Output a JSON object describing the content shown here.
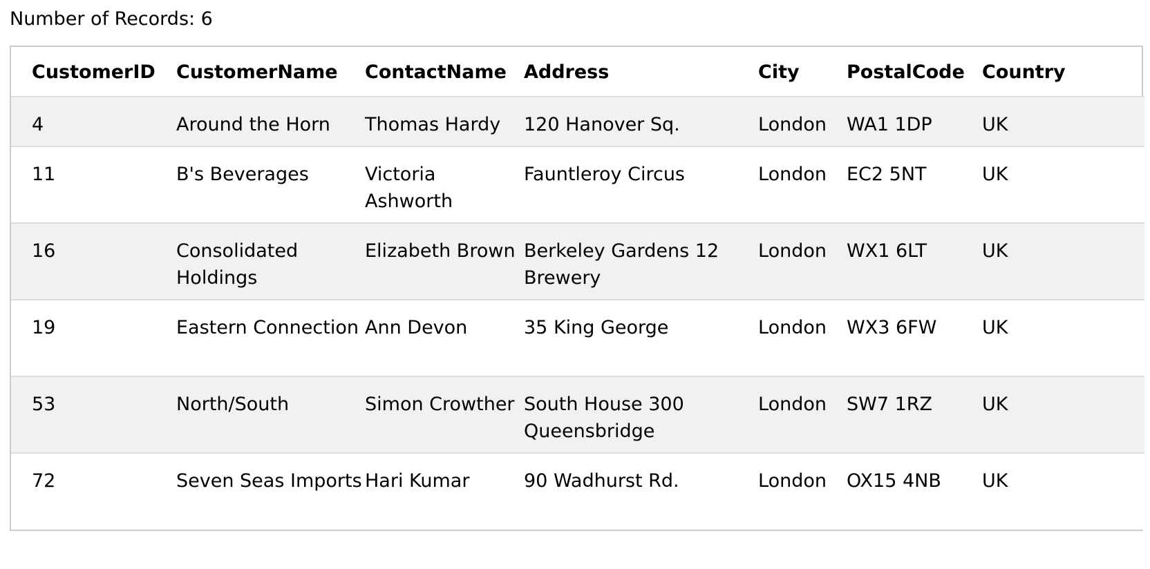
{
  "summary": {
    "records_label": "Number of Records: 6"
  },
  "table": {
    "headers": [
      "CustomerID",
      "CustomerName",
      "ContactName",
      "Address",
      "City",
      "PostalCode",
      "Country"
    ],
    "rows": [
      [
        "4",
        "Around the Horn",
        "Thomas Hardy",
        "120 Hanover Sq.",
        "London",
        "WA1 1DP",
        "UK"
      ],
      [
        "11",
        "B's Beverages",
        "Victoria Ashworth",
        "Fauntleroy Circus",
        "London",
        "EC2 5NT",
        "UK"
      ],
      [
        "16",
        "Consolidated Holdings",
        "Elizabeth Brown",
        "Berkeley Gardens 12 Brewery",
        "London",
        "WX1 6LT",
        "UK"
      ],
      [
        "19",
        "Eastern Connection",
        "Ann Devon",
        "35 King George",
        "London",
        "WX3 6FW",
        "UK"
      ],
      [
        "53",
        "North/South",
        "Simon Crowther",
        "South House 300 Queensbridge",
        "London",
        "SW7 1RZ",
        "UK"
      ],
      [
        "72",
        "Seven Seas Imports",
        "Hari Kumar",
        "90 Wadhurst Rd.",
        "London",
        "OX15 4NB",
        "UK"
      ]
    ]
  }
}
